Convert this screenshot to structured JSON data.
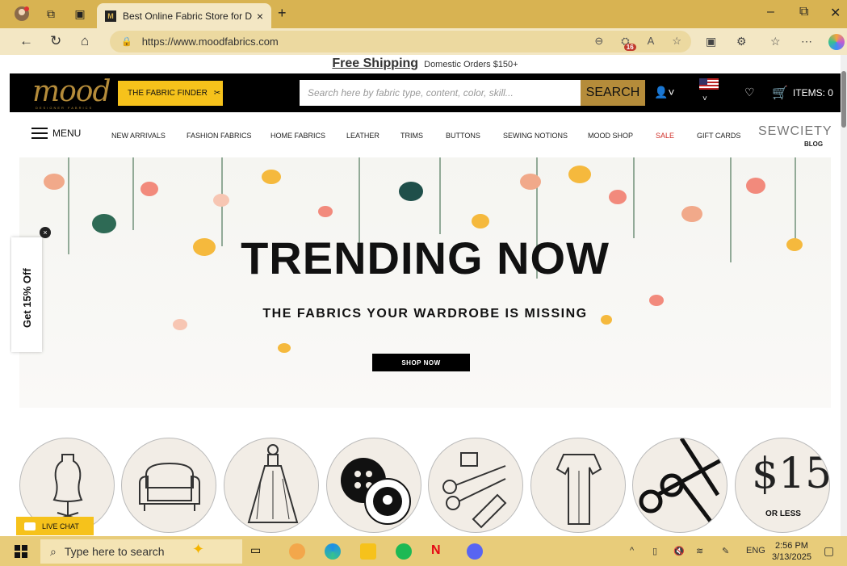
{
  "browser": {
    "tab_title": "Best Online Fabric Store for Desig",
    "tab_favicon": "M",
    "url": "https://www.moodfabrics.com",
    "badge_count": "16",
    "new_tab": "+",
    "tab_close": "×"
  },
  "site": {
    "shipping_big": "Free Shipping",
    "shipping_small": "Domestic Orders $150+",
    "logo": "mood",
    "logo_sub": "DESIGNER FABRICS",
    "finder_label": "THE FABRIC FINDER",
    "search_placeholder": "Search here by fabric type, content, color, skill...",
    "search_button": "SEARCH",
    "cart_label": "ITEMS: 0"
  },
  "nav": {
    "menu_label": "MENU",
    "items": [
      "NEW ARRIVALS",
      "FASHION FABRICS",
      "HOME FABRICS",
      "LEATHER",
      "TRIMS",
      "BUTTONS",
      "SEWING NOTIONS",
      "MOOD SHOP",
      "SALE",
      "GIFT CARDS"
    ],
    "sewciety": "SEWCIETY",
    "sewciety_sub": "BLOG"
  },
  "hero": {
    "title": "TRENDING NOW",
    "subtitle": "THE FABRICS YOUR WARDROBE IS MISSING",
    "button": "SHOP NOW"
  },
  "promo": {
    "offer_tab": "Get 15% Off",
    "close": "×",
    "price_circle": "$15",
    "price_circle_sub": "OR LESS",
    "live_chat": "LIVE CHAT"
  },
  "taskbar": {
    "search_placeholder": "Type here to search",
    "lang": "ENG",
    "time": "2:56 PM",
    "date": "3/13/2025"
  },
  "colors": {
    "chrome": "#d8b352",
    "brand_gold": "#b58c3a",
    "finder_yellow": "#f6c21b",
    "sale_red": "#d0302a"
  }
}
